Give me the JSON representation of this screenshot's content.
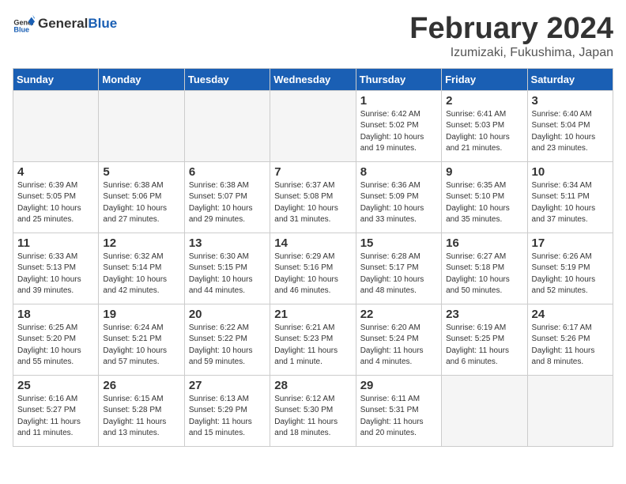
{
  "header": {
    "logo_general": "General",
    "logo_blue": "Blue",
    "title": "February 2024",
    "subtitle": "Izumizaki, Fukushima, Japan"
  },
  "days_of_week": [
    "Sunday",
    "Monday",
    "Tuesday",
    "Wednesday",
    "Thursday",
    "Friday",
    "Saturday"
  ],
  "weeks": [
    [
      {
        "day": "",
        "empty": true
      },
      {
        "day": "",
        "empty": true
      },
      {
        "day": "",
        "empty": true
      },
      {
        "day": "",
        "empty": true
      },
      {
        "day": "1",
        "sunrise": "6:42 AM",
        "sunset": "5:02 PM",
        "daylight": "10 hours and 19 minutes."
      },
      {
        "day": "2",
        "sunrise": "6:41 AM",
        "sunset": "5:03 PM",
        "daylight": "10 hours and 21 minutes."
      },
      {
        "day": "3",
        "sunrise": "6:40 AM",
        "sunset": "5:04 PM",
        "daylight": "10 hours and 23 minutes."
      }
    ],
    [
      {
        "day": "4",
        "sunrise": "6:39 AM",
        "sunset": "5:05 PM",
        "daylight": "10 hours and 25 minutes."
      },
      {
        "day": "5",
        "sunrise": "6:38 AM",
        "sunset": "5:06 PM",
        "daylight": "10 hours and 27 minutes."
      },
      {
        "day": "6",
        "sunrise": "6:38 AM",
        "sunset": "5:07 PM",
        "daylight": "10 hours and 29 minutes."
      },
      {
        "day": "7",
        "sunrise": "6:37 AM",
        "sunset": "5:08 PM",
        "daylight": "10 hours and 31 minutes."
      },
      {
        "day": "8",
        "sunrise": "6:36 AM",
        "sunset": "5:09 PM",
        "daylight": "10 hours and 33 minutes."
      },
      {
        "day": "9",
        "sunrise": "6:35 AM",
        "sunset": "5:10 PM",
        "daylight": "10 hours and 35 minutes."
      },
      {
        "day": "10",
        "sunrise": "6:34 AM",
        "sunset": "5:11 PM",
        "daylight": "10 hours and 37 minutes."
      }
    ],
    [
      {
        "day": "11",
        "sunrise": "6:33 AM",
        "sunset": "5:13 PM",
        "daylight": "10 hours and 39 minutes."
      },
      {
        "day": "12",
        "sunrise": "6:32 AM",
        "sunset": "5:14 PM",
        "daylight": "10 hours and 42 minutes."
      },
      {
        "day": "13",
        "sunrise": "6:30 AM",
        "sunset": "5:15 PM",
        "daylight": "10 hours and 44 minutes."
      },
      {
        "day": "14",
        "sunrise": "6:29 AM",
        "sunset": "5:16 PM",
        "daylight": "10 hours and 46 minutes."
      },
      {
        "day": "15",
        "sunrise": "6:28 AM",
        "sunset": "5:17 PM",
        "daylight": "10 hours and 48 minutes."
      },
      {
        "day": "16",
        "sunrise": "6:27 AM",
        "sunset": "5:18 PM",
        "daylight": "10 hours and 50 minutes."
      },
      {
        "day": "17",
        "sunrise": "6:26 AM",
        "sunset": "5:19 PM",
        "daylight": "10 hours and 52 minutes."
      }
    ],
    [
      {
        "day": "18",
        "sunrise": "6:25 AM",
        "sunset": "5:20 PM",
        "daylight": "10 hours and 55 minutes."
      },
      {
        "day": "19",
        "sunrise": "6:24 AM",
        "sunset": "5:21 PM",
        "daylight": "10 hours and 57 minutes."
      },
      {
        "day": "20",
        "sunrise": "6:22 AM",
        "sunset": "5:22 PM",
        "daylight": "10 hours and 59 minutes."
      },
      {
        "day": "21",
        "sunrise": "6:21 AM",
        "sunset": "5:23 PM",
        "daylight": "11 hours and 1 minute."
      },
      {
        "day": "22",
        "sunrise": "6:20 AM",
        "sunset": "5:24 PM",
        "daylight": "11 hours and 4 minutes."
      },
      {
        "day": "23",
        "sunrise": "6:19 AM",
        "sunset": "5:25 PM",
        "daylight": "11 hours and 6 minutes."
      },
      {
        "day": "24",
        "sunrise": "6:17 AM",
        "sunset": "5:26 PM",
        "daylight": "11 hours and 8 minutes."
      }
    ],
    [
      {
        "day": "25",
        "sunrise": "6:16 AM",
        "sunset": "5:27 PM",
        "daylight": "11 hours and 11 minutes."
      },
      {
        "day": "26",
        "sunrise": "6:15 AM",
        "sunset": "5:28 PM",
        "daylight": "11 hours and 13 minutes."
      },
      {
        "day": "27",
        "sunrise": "6:13 AM",
        "sunset": "5:29 PM",
        "daylight": "11 hours and 15 minutes."
      },
      {
        "day": "28",
        "sunrise": "6:12 AM",
        "sunset": "5:30 PM",
        "daylight": "11 hours and 18 minutes."
      },
      {
        "day": "29",
        "sunrise": "6:11 AM",
        "sunset": "5:31 PM",
        "daylight": "11 hours and 20 minutes."
      },
      {
        "day": "",
        "empty": true
      },
      {
        "day": "",
        "empty": true
      }
    ]
  ]
}
